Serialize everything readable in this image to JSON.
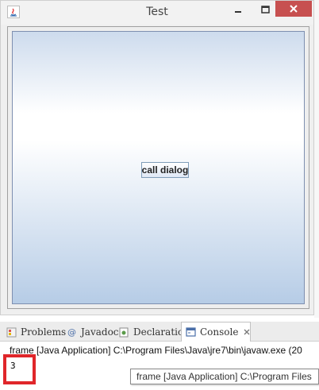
{
  "window": {
    "title": "Test"
  },
  "panel": {
    "button_label": "call dialog"
  },
  "views": {
    "tabs": [
      {
        "label": "Problems",
        "icon": "problems-icon"
      },
      {
        "label": "Javadoc",
        "icon": "javadoc-icon"
      },
      {
        "label": "Declaration",
        "icon": "declaration-icon"
      },
      {
        "label": "Console",
        "icon": "console-icon",
        "active": true
      }
    ],
    "console_header": "frame [Java Application] C:\\Program Files\\Java\\jre7\\bin\\javaw.exe (20",
    "output": "3",
    "tooltip": "frame [Java Application] C:\\Program Files"
  },
  "colors": {
    "close_button": "#c75050",
    "highlight": "#e0262a",
    "panel_top": "#cddbed",
    "panel_bottom": "#b6cce6"
  }
}
